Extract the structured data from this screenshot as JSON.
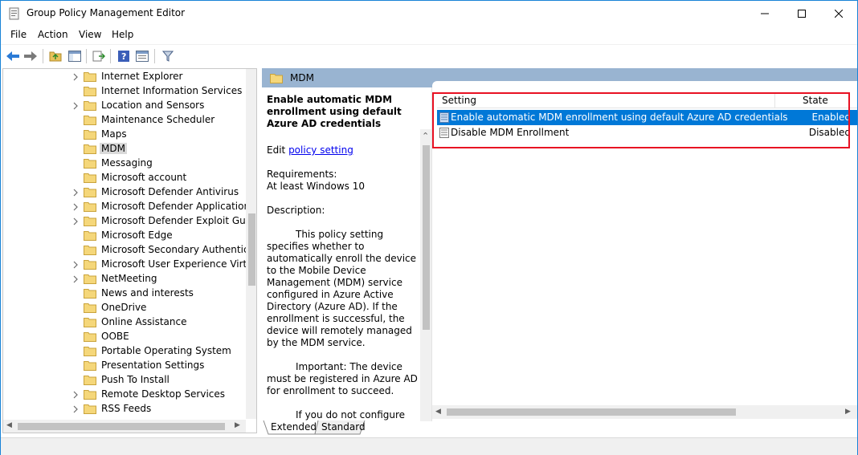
{
  "window": {
    "title": "Group Policy Management Editor",
    "accent": "#1883d7"
  },
  "menubar": {
    "items": [
      "File",
      "Action",
      "View",
      "Help"
    ]
  },
  "tree": {
    "items": [
      {
        "label": "Internet Explorer",
        "expandable": true
      },
      {
        "label": "Internet Information Services",
        "expandable": false
      },
      {
        "label": "Location and Sensors",
        "expandable": true
      },
      {
        "label": "Maintenance Scheduler",
        "expandable": false
      },
      {
        "label": "Maps",
        "expandable": false
      },
      {
        "label": "MDM",
        "expandable": false,
        "selected": true
      },
      {
        "label": "Messaging",
        "expandable": false
      },
      {
        "label": "Microsoft account",
        "expandable": false
      },
      {
        "label": "Microsoft Defender Antivirus",
        "expandable": true
      },
      {
        "label": "Microsoft Defender Application Gu",
        "expandable": true
      },
      {
        "label": "Microsoft Defender Exploit Guard",
        "expandable": true
      },
      {
        "label": "Microsoft Edge",
        "expandable": false
      },
      {
        "label": "Microsoft Secondary Authenticatio",
        "expandable": false
      },
      {
        "label": "Microsoft User Experience Virtuali",
        "expandable": true
      },
      {
        "label": "NetMeeting",
        "expandable": true
      },
      {
        "label": "News and interests",
        "expandable": false
      },
      {
        "label": "OneDrive",
        "expandable": false
      },
      {
        "label": "Online Assistance",
        "expandable": false
      },
      {
        "label": "OOBE",
        "expandable": false
      },
      {
        "label": "Portable Operating System",
        "expandable": false
      },
      {
        "label": "Presentation Settings",
        "expandable": false
      },
      {
        "label": "Push To Install",
        "expandable": false
      },
      {
        "label": "Remote Desktop Services",
        "expandable": true
      },
      {
        "label": "RSS Feeds",
        "expandable": true
      }
    ]
  },
  "header": {
    "title": "MDM",
    "color": "#99b4d1"
  },
  "description": {
    "title": "Enable automatic MDM enrollment using default Azure AD credentials",
    "edit_prefix": "Edit ",
    "edit_link": "policy setting ",
    "requirements_label": "Requirements:",
    "requirements_value": "At least Windows 10",
    "description_label": "Description:",
    "para1": "This policy setting specifies whether to automatically enroll the device to the Mobile Device Management (MDM) service configured in Azure Active Directory (Azure AD). If the enrollment is successful, the device will remotely managed by the MDM service.",
    "para2": "Important: The device must be registered in Azure AD for enrollment to succeed.",
    "para3": "If you do not configure this policy setting, automatic MDM enrollment will not be initiated."
  },
  "list": {
    "col_setting": "Setting",
    "col_state": "State",
    "rows": [
      {
        "name": "Enable automatic MDM enrollment using default Azure AD credentials",
        "state": "Enabled",
        "selected": true
      },
      {
        "name": "Disable MDM Enrollment",
        "state": "Disabled",
        "selected": false
      }
    ],
    "selection_color": "#0078d7",
    "highlight_color": "#e81123"
  },
  "tabs": {
    "extended": "Extended",
    "standard": "Standard"
  }
}
